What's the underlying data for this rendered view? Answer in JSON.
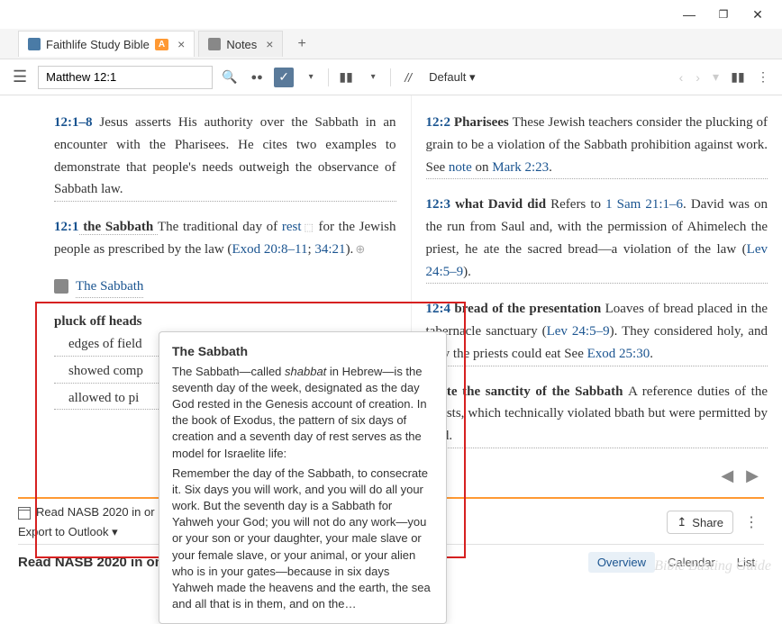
{
  "window": {
    "minimize": "—",
    "maximize": "❐",
    "close": "✕"
  },
  "tabs": [
    {
      "label": "Faithlife Study Bible",
      "badge": "A"
    },
    {
      "label": "Notes"
    }
  ],
  "toolbar": {
    "reference": "Matthew 12:1",
    "layout_label": "Default"
  },
  "col1": {
    "p1_ref": "12:1–8",
    "p1_text": " Jesus asserts His authority over the Sabbath in an encounter with the Pharisees. He cites two examples to demonstrate that people's needs outweigh the observance of Sabbath law.",
    "p2_ref": "12:1",
    "p2_term": " the Sabbath ",
    "p2_a": "The traditional day of ",
    "p2_link1": "rest",
    "p2_b": " for the Jewish people as prescribed by the law (",
    "p2_link2": "Exod 20:8–11",
    "p2_c": "; ",
    "p2_link3": "34:21",
    "p2_d": ").",
    "factbook_label": "The Sabbath",
    "p3_term": "pluck off heads",
    "p3_a": "edges of field",
    "p3_b": "showed comp",
    "p3_c": "allowed to pi"
  },
  "col2": {
    "p1_ref": "12:2",
    "p1_term": " Pharisees ",
    "p1_a": "These Jewish teachers consider the plucking of grain to be a violation of the Sabbath prohibition against work. See ",
    "p1_link1": "note",
    "p1_b": " on ",
    "p1_link2": "Mark 2:23",
    "p1_c": ".",
    "p2_ref": "12:3",
    "p2_term": " what David did ",
    "p2_a": "Refers to ",
    "p2_link1": "1 Sam 21:1–6",
    "p2_b": ". David was on the run from Saul and, with the permission of Ahimelech the priest, he ate the sacred bread—a vio­lation of the law (",
    "p2_link2": "Lev 24:5–9",
    "p2_c": ").",
    "p3_ref": "12:4",
    "p3_term": " bread of the presentation ",
    "p3_a": "Loaves of bread placed in the tabernacle sanctuary (",
    "p3_link1": "Lev 24:5–9",
    "p3_b": "). They considered holy, and only the priests could eat See ",
    "p3_link2": "Exod 25:30",
    "p3_c": ".",
    "p4_term": "iolate the sanctity of the Sabbath ",
    "p4_a": "A reference duties of the priests, which technically violated bbath but were permitted by God."
  },
  "tooltip": {
    "title": "The Sabbath",
    "body_a": "The Sabbath—called ",
    "body_em": "shabbat",
    "body_b": " in Hebrew—is the seventh day of the week, designated as the day God rested in the Genesis account of creation. In the book of Exodus, the pattern of six days of creation and a seventh day of rest serves as the model for Israelite life:",
    "body_c": "Remember the day of the Sabbath, to consecrate it. Six days you will work, and you will do all your work. But the seventh day is a Sabbath for Yahweh your God; you will not do any work—you or your son or your daughter, your male slave or your female slave, or your animal, or your alien who is in your gates—because in six days Yahweh made the heavens and the earth, the sea and all that is in them, and on the…"
  },
  "footer1": {
    "line1": "Read NASB 2020 in or",
    "line2": "Export to Outlook",
    "share": "Share"
  },
  "footer2": {
    "title": "Read NASB 2020 in one year",
    "tabs": [
      "Overview",
      "Calendar",
      "List"
    ]
  },
  "watermark": "Bible\nBusting\nGuide"
}
